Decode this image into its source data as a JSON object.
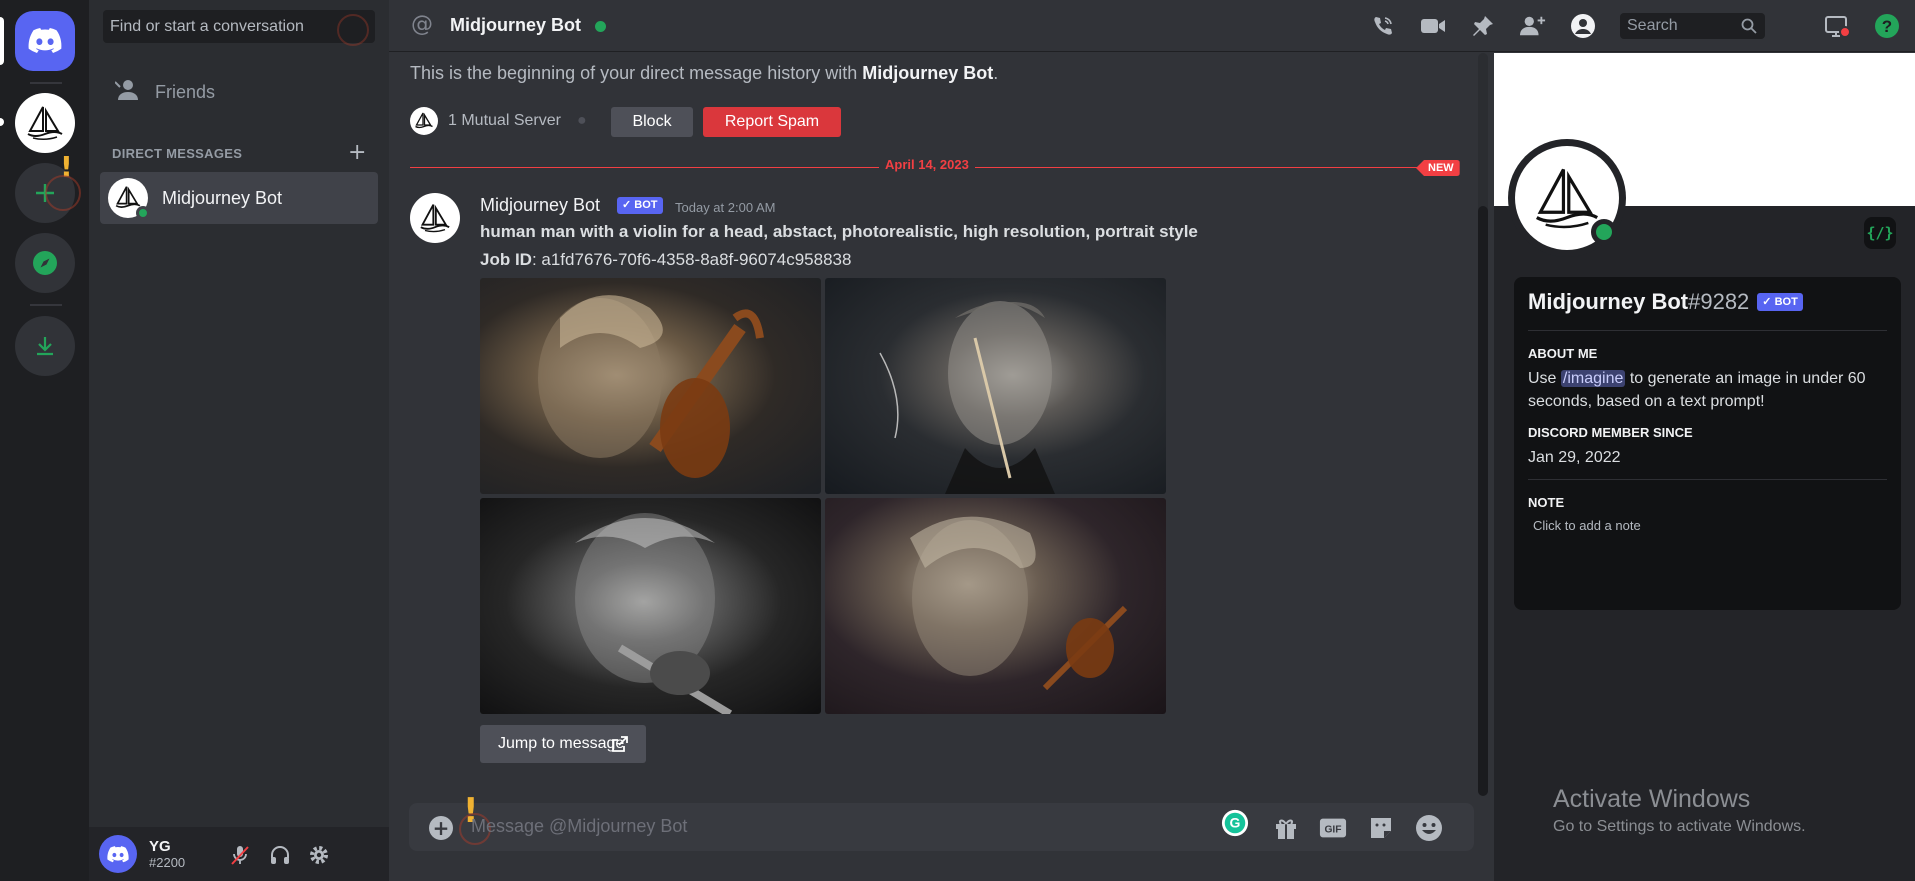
{
  "rail": {
    "home_icon": "discord-logo-icon",
    "server_icon": "midjourney-boat-icon",
    "add_icon": "plus-icon",
    "explore_icon": "compass-icon",
    "download_icon": "download-icon"
  },
  "dm_list": {
    "search_placeholder": "Find or start a conversation",
    "friends_label": "Friends",
    "section_title": "DIRECT MESSAGES",
    "items": [
      {
        "name": "Midjourney Bot",
        "status": "online"
      }
    ]
  },
  "user": {
    "name": "YG",
    "tag": "#2200"
  },
  "header": {
    "channel_name": "Midjourney Bot",
    "search_placeholder": "Search"
  },
  "chat": {
    "intro_prefix": "This is the beginning of your direct message history with",
    "intro_name": "Midjourney Bot",
    "intro_suffix": ".",
    "mutual_servers": "1 Mutual Server",
    "block_label": "Block",
    "report_label": "Report Spam",
    "date_divider": "April 14, 2023",
    "new_label": "NEW",
    "message": {
      "author": "Midjourney Bot",
      "badge": "✓ BOT",
      "timestamp": "Today at 2:00 AM",
      "prompt": "human man with a violin for a head, abstact, photorealistic, high resolution, portrait style",
      "job_label": "Job ID",
      "job_id": ": a1fd7676-70f6-4358-8a8f-96074c958838",
      "images": [
        "violin-portrait-1",
        "violin-portrait-2",
        "violin-portrait-3",
        "violin-portrait-4"
      ],
      "jump_label": "Jump to message"
    },
    "composer_placeholder": "Message @Midjourney Bot"
  },
  "profile": {
    "name": "Midjourney Bot",
    "discriminator": "#9282",
    "badge": "✓ BOT",
    "code_badge": "{/}",
    "about_title": "ABOUT ME",
    "about_pre": "Use",
    "about_cmd": "/imagine",
    "about_post": "to generate an image in under 60 seconds, based on a text prompt!",
    "member_since_title": "DISCORD MEMBER SINCE",
    "member_since": "Jan 29, 2022",
    "note_title": "NOTE",
    "note_placeholder": "Click to add a note"
  },
  "watermark": {
    "line1": "Activate Windows",
    "line2": "Go to Settings to activate Windows."
  },
  "colors": {
    "blurple": "#5865f2",
    "online": "#23a55a",
    "danger": "#f23f43"
  }
}
